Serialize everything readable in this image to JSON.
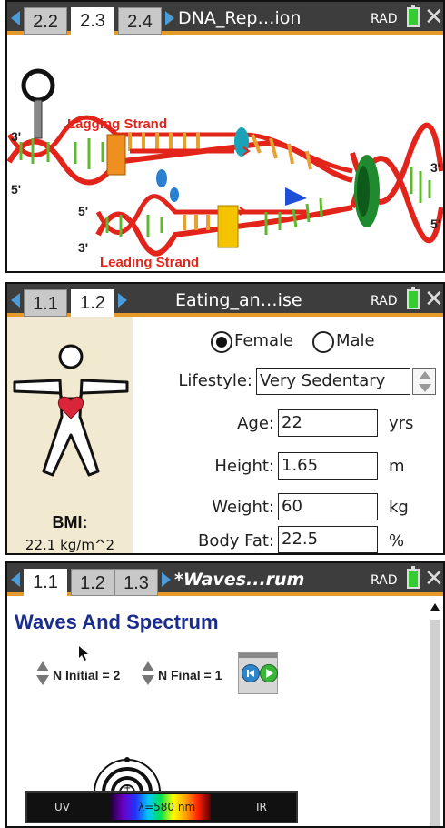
{
  "panel1": {
    "tabs": [
      "2.2",
      "2.3",
      "2.4"
    ],
    "active_tab": "2.3",
    "doc_title": "DNA_Rep…ion",
    "angle_mode": "RAD",
    "lagging_label": "Lagging Strand",
    "leading_label": "Leading Strand",
    "primes": [
      "3'",
      "5'",
      "5'",
      "3'",
      "3'",
      "5'"
    ],
    "colors": {
      "strand": "#e2241b",
      "base_green": "#5fb82c",
      "base_orange": "#e5a233",
      "helicase": "#1f8a2e",
      "primase": "#1aa3b6"
    }
  },
  "panel2": {
    "tabs": [
      "1.1",
      "1.2"
    ],
    "active_tab": "1.2",
    "doc_title": "Eating_an…ise",
    "angle_mode": "RAD",
    "gender_female": "Female",
    "gender_male": "Male",
    "lifestyle_label": "Lifestyle:",
    "lifestyle_value": "Very Sedentary",
    "age_label": "Age:",
    "age_value": "22",
    "age_unit": "yrs",
    "height_label": "Height:",
    "height_value": "1.65",
    "height_unit": "m",
    "weight_label": "Weight:",
    "weight_value": "60",
    "weight_unit": "kg",
    "bodyfat_label": "Body Fat:",
    "bodyfat_value": "22.5",
    "bodyfat_unit": "%",
    "bmi_label": "BMI:",
    "bmi_value": "22.1 kg/m^2"
  },
  "panel3": {
    "tabs": [
      "1.1",
      "1.2",
      "1.3"
    ],
    "active_tab": "1.1",
    "doc_title": "*Waves...rum",
    "angle_mode": "RAD",
    "heading": "Waves And Spectrum",
    "n_initial": "N Initial = 2",
    "n_final": "N Final = 1",
    "spectrum_uv": "UV",
    "spectrum_ir": "IR",
    "wavelength": "λ=580 nm"
  }
}
